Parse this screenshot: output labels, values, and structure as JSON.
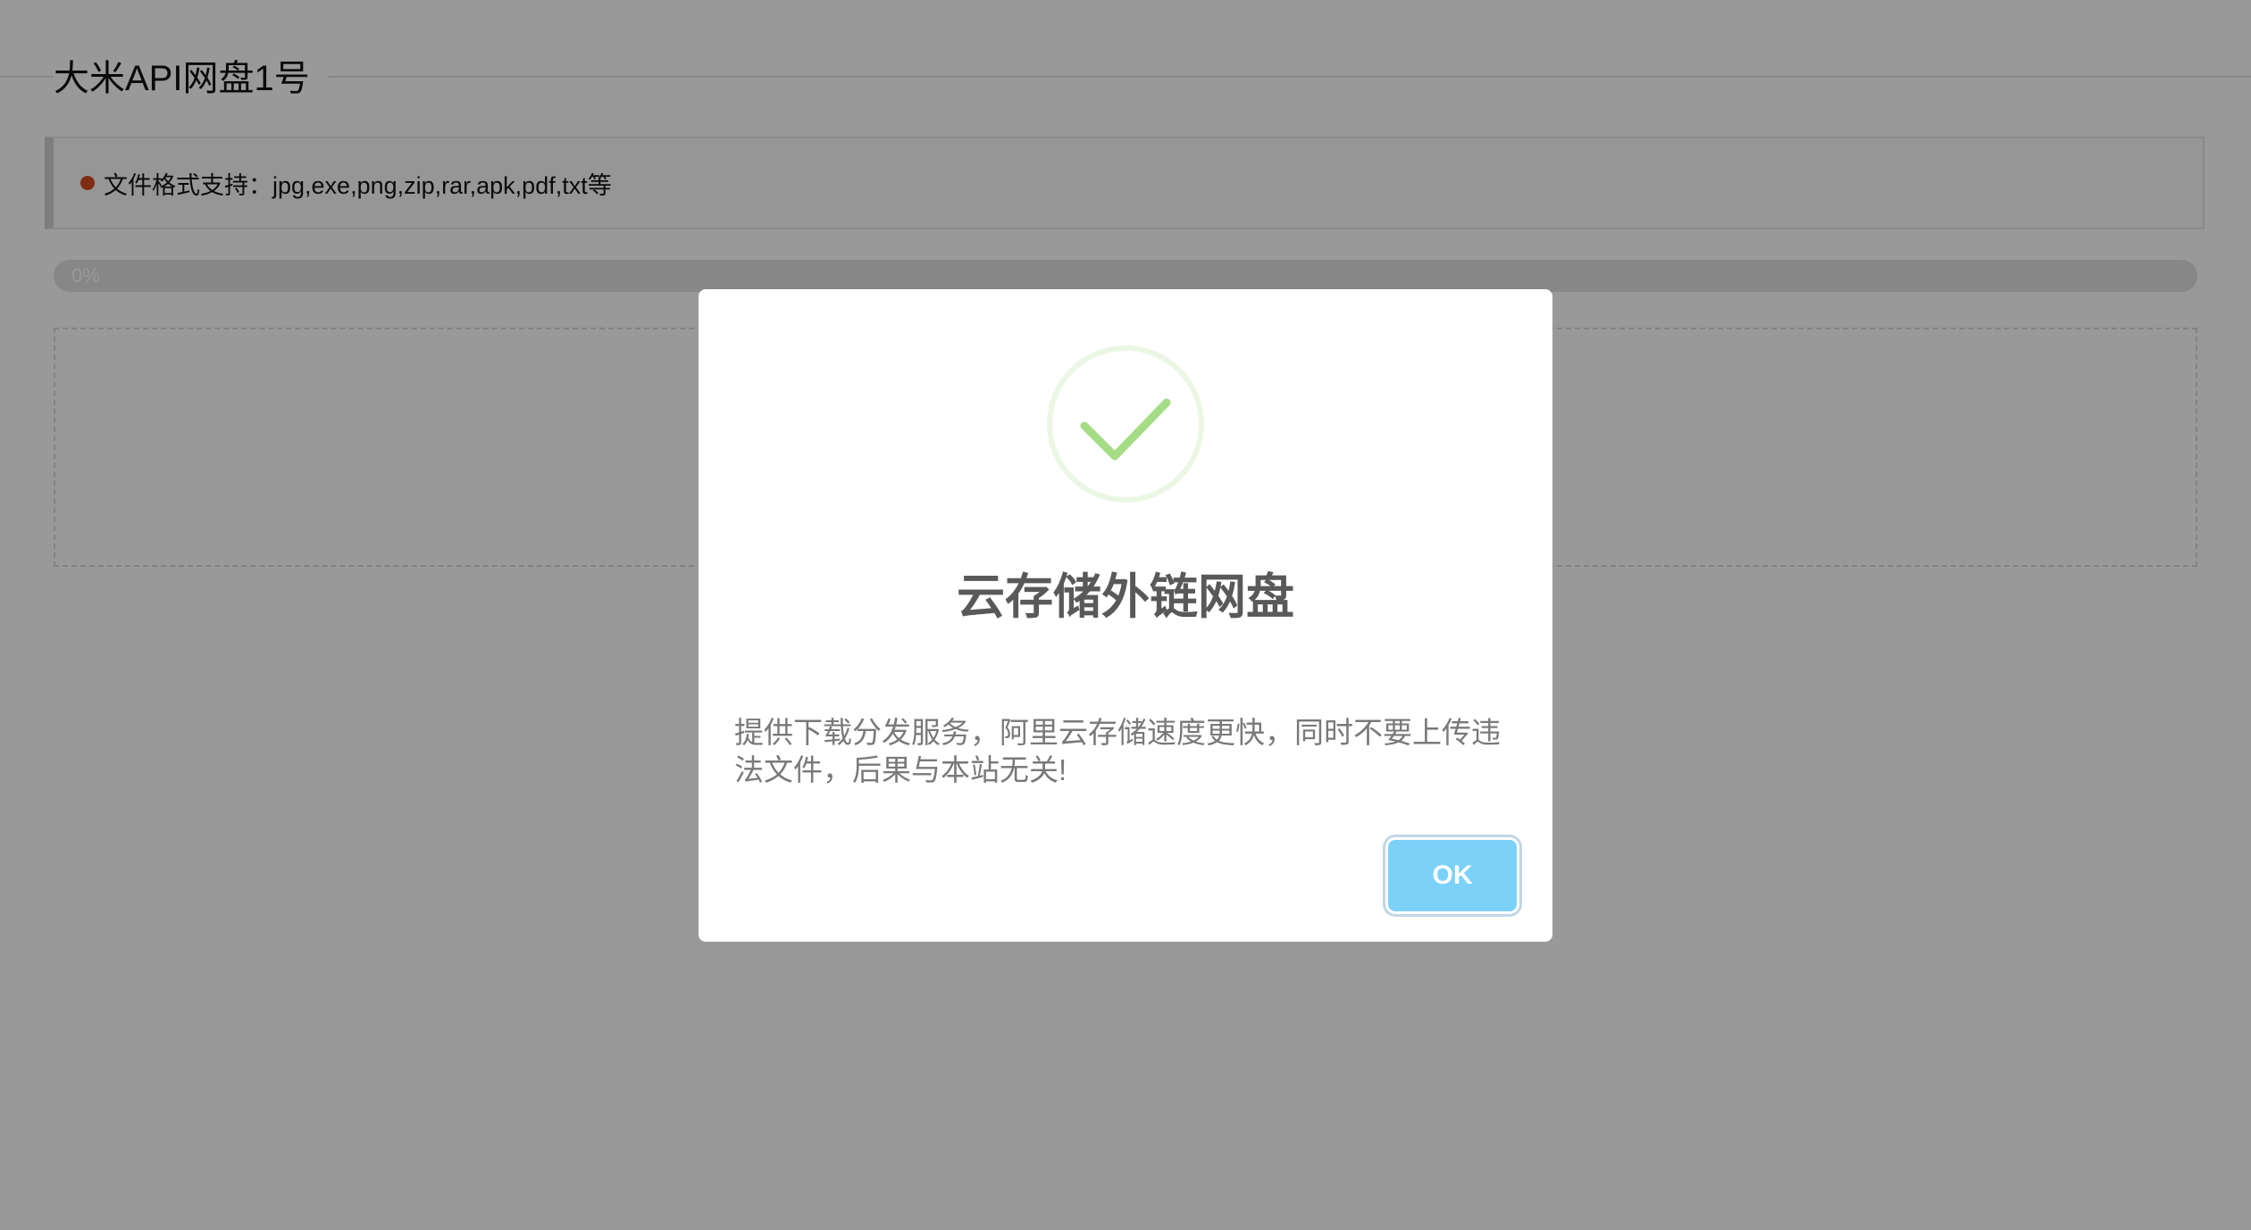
{
  "page": {
    "title": "大米API网盘1号"
  },
  "notice": {
    "text": "文件格式支持：jpg,exe,png,zip,rar,apk,pdf,txt等",
    "dot_color": "#d24a1f"
  },
  "progress": {
    "label": "0%",
    "value": 0
  },
  "modal": {
    "icon": "success-check-icon",
    "title": "云存储外链网盘",
    "text": "提供下载分发服务，阿里云存储速度更快，同时不要上传违法文件，后果与本站无关!",
    "ok_label": "OK",
    "accent_color": "#7cd1f9",
    "check_color": "#a5dc86"
  }
}
